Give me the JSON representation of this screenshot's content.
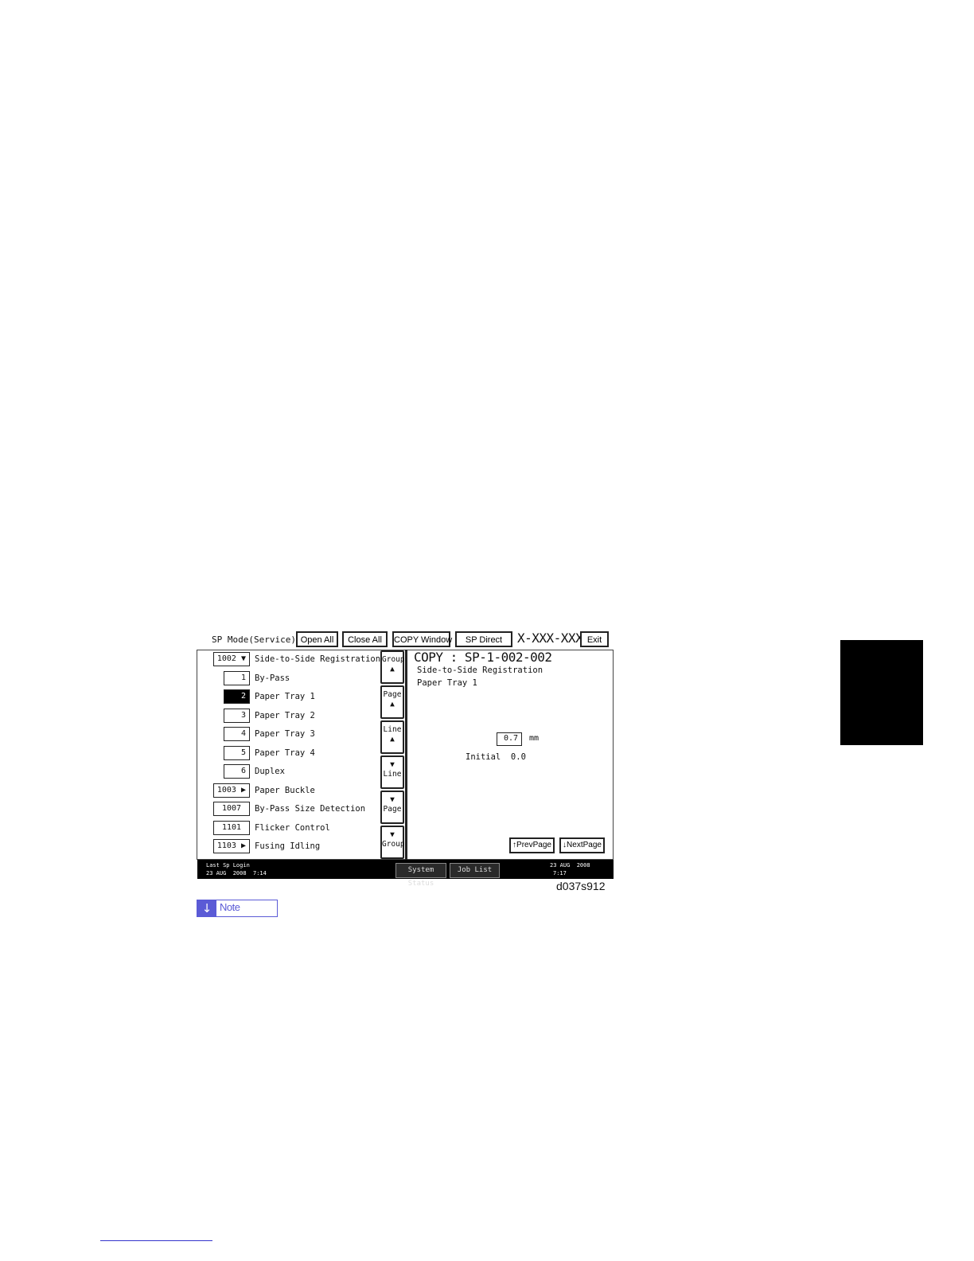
{
  "header": {
    "title": "SP Mode(Service)",
    "buttons": [
      "Open All",
      "Close All",
      "COPY Window",
      "SP Direct"
    ],
    "code": "X-XXX-XXX",
    "exit": "Exit"
  },
  "list": {
    "rows": [
      {
        "num": "1002 ▼",
        "label": "Side-to-Side Registration"
      },
      {
        "num": "1",
        "label": "By-Pass"
      },
      {
        "num": "2",
        "label": "Paper Tray 1",
        "selected": true
      },
      {
        "num": "3",
        "label": "Paper Tray 2"
      },
      {
        "num": "4",
        "label": "Paper Tray 3"
      },
      {
        "num": "5",
        "label": "Paper Tray 4"
      },
      {
        "num": "6",
        "label": "Duplex"
      },
      {
        "num": "1003 ▶",
        "label": "Paper Buckle"
      },
      {
        "num": "1007",
        "label": "By-Pass Size Detection"
      },
      {
        "num": "1101",
        "label": "Flicker Control"
      },
      {
        "num": "1103 ▶",
        "label": "Fusing Idling"
      }
    ]
  },
  "nav": {
    "group_up": "Group",
    "page_up": "Page",
    "line_up": "Line",
    "line_down": "Line",
    "page_down": "Page",
    "group_down": "Group",
    "up_arrow": "▲",
    "down_arrow": "▼"
  },
  "detail": {
    "title": "COPY : SP-1-002-002",
    "line1": "Side-to-Side Registration",
    "line2": "Paper Tray 1",
    "value": "0.7",
    "unit": "mm",
    "initial_label": "Initial",
    "initial_value": "0.0",
    "prev": "↑PrevPage",
    "next": "↓NextPage"
  },
  "status": {
    "last_login_label": "Last Sp Login",
    "last_login_time": "23 AUG  2008  7:14",
    "system_status": "System Status",
    "job_list": "Job List",
    "date": "23 AUG  2008",
    "time": "7:17"
  },
  "figure_id": "d037s912",
  "note": {
    "label": "Note"
  }
}
